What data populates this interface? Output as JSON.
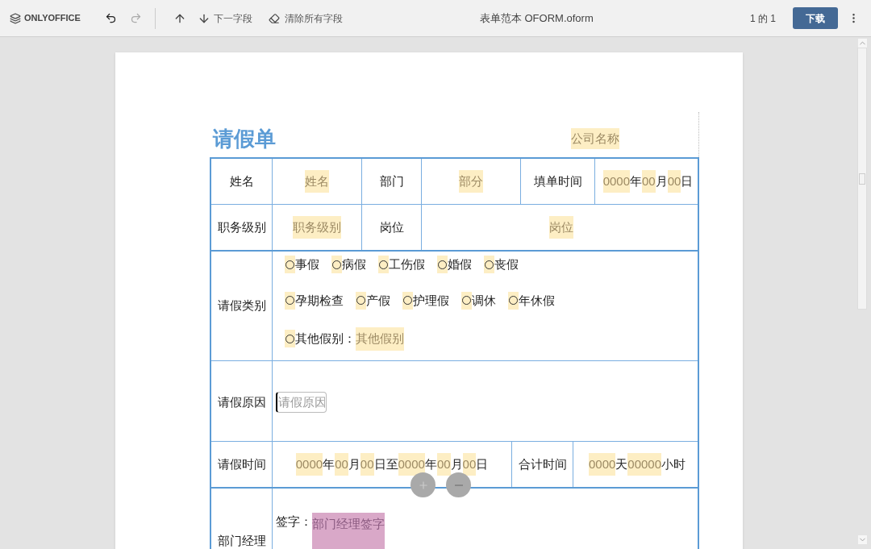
{
  "toolbar": {
    "logo": "ONLYOFFICE",
    "next_field": "下一字段",
    "clear_fields": "清除所有字段",
    "document_title": "表单范本 OFORM.oform",
    "page_counter": "1 的 1",
    "download": "下载"
  },
  "form": {
    "title": "请假单",
    "company_field": "公司名称",
    "rows": [
      {
        "kind": "grid6",
        "cells": [
          [
            {
              "kind": "text",
              "text": "姓名"
            }
          ],
          [
            {
              "kind": "field",
              "text": "姓名"
            }
          ],
          [
            {
              "kind": "text",
              "text": "部门"
            }
          ],
          [
            {
              "kind": "field",
              "text": "部分"
            }
          ],
          [
            {
              "kind": "text",
              "text": "填单时间"
            }
          ],
          [
            {
              "kind": "field",
              "text": "0000"
            },
            {
              "kind": "text",
              "text": "年"
            },
            {
              "kind": "field",
              "text": "00"
            },
            {
              "kind": "text",
              "text": "月"
            },
            {
              "kind": "field",
              "text": "00"
            },
            {
              "kind": "text",
              "text": "日"
            }
          ]
        ]
      },
      {
        "kind": "grid4",
        "cells": [
          [
            {
              "kind": "text",
              "text": "职务级别"
            }
          ],
          [
            {
              "kind": "field",
              "text": "职务级别"
            }
          ],
          [
            {
              "kind": "text",
              "text": "岗位"
            }
          ],
          [
            {
              "kind": "field",
              "text": "岗位"
            }
          ]
        ]
      },
      {
        "kind": "leave_types",
        "label": "请假类别",
        "lines": [
          [
            {
              "label": "事假",
              "selected": false
            },
            {
              "label": "病假",
              "selected": false
            },
            {
              "label": "工伤假",
              "selected": false
            },
            {
              "label": "婚假",
              "selected": false
            },
            {
              "label": "丧假",
              "selected": false
            }
          ],
          [
            {
              "label": "孕期检查",
              "selected": false
            },
            {
              "label": "产假",
              "selected": false
            },
            {
              "label": "护理假",
              "selected": false
            },
            {
              "label": "调休",
              "selected": false
            },
            {
              "label": "年休假",
              "selected": false
            }
          ],
          [
            {
              "label": "其他假别：",
              "selected": false,
              "field": "其他假别"
            }
          ]
        ]
      },
      {
        "kind": "reason",
        "label": "请假原因",
        "placeholder": "请假原因"
      },
      {
        "kind": "period",
        "cells": [
          [
            {
              "kind": "text",
              "text": "请假时间"
            }
          ],
          [
            {
              "kind": "field",
              "text": "0000"
            },
            {
              "kind": "text",
              "text": "年"
            },
            {
              "kind": "field",
              "text": "00"
            },
            {
              "kind": "text",
              "text": "月"
            },
            {
              "kind": "field",
              "text": "00"
            },
            {
              "kind": "text",
              "text": "日至"
            },
            {
              "kind": "field",
              "text": "0000"
            },
            {
              "kind": "text",
              "text": "年"
            },
            {
              "kind": "field",
              "text": "00"
            },
            {
              "kind": "text",
              "text": "月"
            },
            {
              "kind": "field",
              "text": "00"
            },
            {
              "kind": "text",
              "text": "日"
            }
          ],
          [
            {
              "kind": "text",
              "text": "合计时间"
            }
          ],
          [
            {
              "kind": "field",
              "text": "0000"
            },
            {
              "kind": "text",
              "text": "天"
            },
            {
              "kind": "field",
              "text": "00000"
            },
            {
              "kind": "text",
              "text": "小时"
            }
          ]
        ]
      },
      {
        "kind": "signature",
        "label": "部门经理",
        "cells": [
          {
            "kind": "text",
            "text": "签字："
          },
          {
            "kind": "signature",
            "text": "部门经理签字"
          }
        ]
      }
    ]
  }
}
